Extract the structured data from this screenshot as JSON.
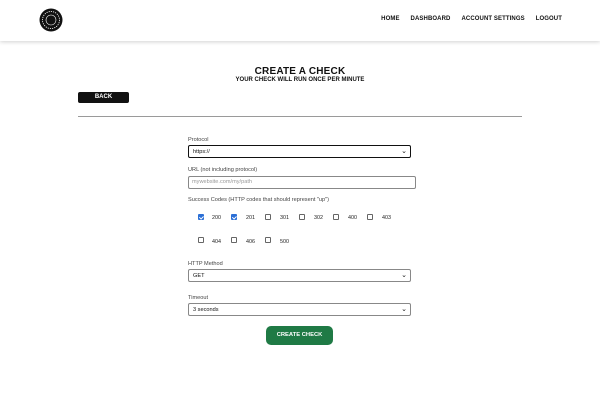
{
  "nav": {
    "home": "HOME",
    "dashboard": "DASHBOARD",
    "account_settings": "ACCOUNT SETTINGS",
    "logout": "LOGOUT"
  },
  "header": {
    "title": "CREATE A CHECK",
    "subtitle": "YOUR CHECK WILL RUN ONCE PER MINUTE"
  },
  "back_label": "BACK",
  "form": {
    "protocol": {
      "label": "Protocol",
      "value": "https://"
    },
    "url": {
      "label": "URL (not including protocol)",
      "placeholder": "mywebsite.com/my/path"
    },
    "success_codes": {
      "label": "Success Codes (HTTP codes that should represent \"up\")",
      "codes": [
        {
          "code": "200",
          "checked": true
        },
        {
          "code": "201",
          "checked": true
        },
        {
          "code": "301",
          "checked": false
        },
        {
          "code": "302",
          "checked": false
        },
        {
          "code": "400",
          "checked": false
        },
        {
          "code": "403",
          "checked": false
        },
        {
          "code": "404",
          "checked": false
        },
        {
          "code": "406",
          "checked": false
        },
        {
          "code": "500",
          "checked": false
        }
      ]
    },
    "method": {
      "label": "HTTP Method",
      "value": "GET"
    },
    "timeout": {
      "label": "Timeout",
      "value": "3 seconds"
    },
    "submit_label": "CREATE CHECK"
  },
  "colors": {
    "primary_button": "#1f7a45",
    "back_button": "#111111",
    "checkbox_checked": "#2b6fd6"
  },
  "icons": {
    "logo": "circle-logo-icon",
    "select_arrow": "chevron-down-icon"
  }
}
